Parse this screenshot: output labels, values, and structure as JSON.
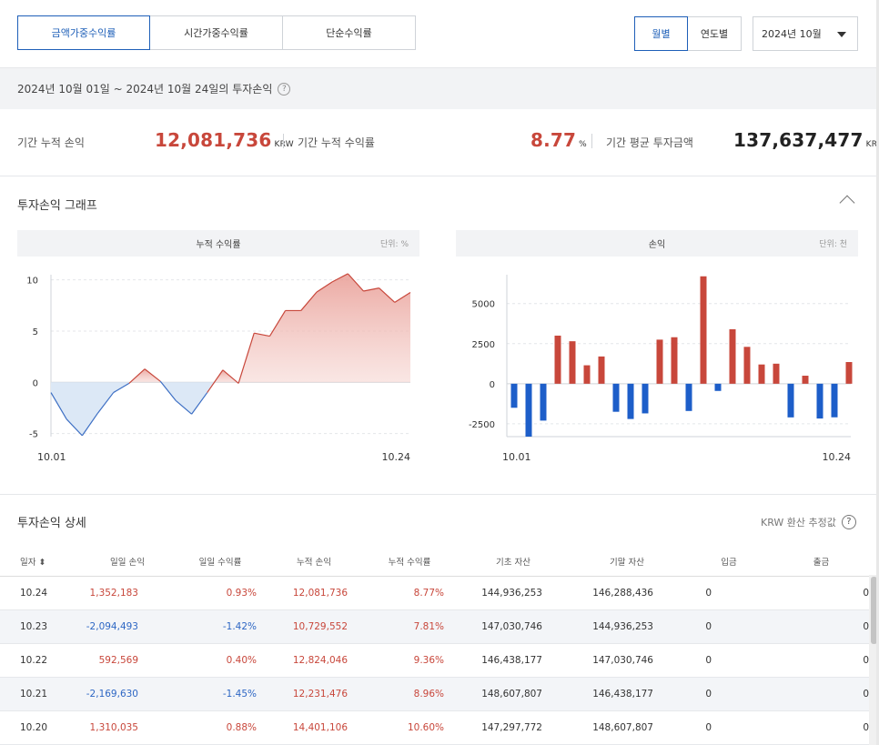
{
  "tabs": {
    "return_type": [
      "금액가중수익률",
      "시간가중수익률",
      "단순수익률"
    ],
    "period_mode": [
      "월별",
      "연도별"
    ],
    "month_select": "2024년 10월"
  },
  "period": {
    "text": "2024년 10월 01일 ~ 2024년 10월 24일의 투자손익",
    "help": "?"
  },
  "summary": {
    "cum_pl_label": "기간 누적 손익",
    "cum_pl_value": "12,081,736",
    "cum_pl_unit": "KRW",
    "cum_rate_label": "기간 누적 수익률",
    "cum_rate_value": "8.77",
    "cum_rate_unit": "%",
    "avg_invest_label": "기간 평균 투자금액",
    "avg_invest_value": "137,637,477",
    "avg_invest_unit": "KRW"
  },
  "graph_section": {
    "title": "투자손익 그래프"
  },
  "chart_data": [
    {
      "type": "area",
      "title": "누적 수익률",
      "unit_label": "단위: %",
      "x_labels": [
        "10.01",
        "10.24"
      ],
      "y_ticks": [
        10,
        5,
        0,
        -5
      ],
      "ylim": [
        -5.3,
        10.5
      ],
      "values": [
        -1.0,
        -3.6,
        -5.2,
        -3.0,
        -1.0,
        -0.1,
        1.3,
        0.1,
        -1.8,
        -3.1,
        -1.0,
        1.2,
        -0.1,
        4.8,
        4.5,
        7.0,
        7.0,
        8.8,
        9.8,
        10.6,
        8.9,
        9.2,
        7.8,
        8.77
      ],
      "colors": {
        "positive": "#c8473b",
        "negative": "#3d6fc4"
      }
    },
    {
      "type": "bar",
      "title": "손익",
      "unit_label": "단위: 천",
      "x_labels": [
        "10.01",
        "10.24"
      ],
      "y_ticks": [
        5000,
        2500,
        0,
        -2500
      ],
      "ylim": [
        -3300,
        6800
      ],
      "values": [
        -1500,
        -3300,
        -2300,
        3000,
        2650,
        1150,
        1700,
        -1750,
        -2200,
        -1850,
        2750,
        2900,
        -1700,
        6700,
        -450,
        3400,
        2300,
        1200,
        1250,
        -2100,
        500,
        -2169.63,
        -2094.493,
        1352.183
      ],
      "colors": {
        "positive": "#c8473b",
        "negative": "#1d5ec9"
      }
    }
  ],
  "detail": {
    "title": "투자손익 상세",
    "estimate": "KRW 환산 추정값",
    "help": "?",
    "columns": [
      "일자 ⬍",
      "일일 손익",
      "일일 수익률",
      "누적 손익",
      "누적 수익률",
      "기초 자산",
      "기말 자산",
      "입금",
      "출금"
    ],
    "rows": [
      {
        "date": "10.24",
        "daily_pl": "1,352,183",
        "daily_rate": "0.93%",
        "cum_pl": "12,081,736",
        "cum_rate": "8.77%",
        "begin": "144,936,253",
        "end": "146,288,436",
        "deposit": "0",
        "withdraw": "0",
        "sign": "pos"
      },
      {
        "date": "10.23",
        "daily_pl": "-2,094,493",
        "daily_rate": "-1.42%",
        "cum_pl": "10,729,552",
        "cum_rate": "7.81%",
        "begin": "147,030,746",
        "end": "144,936,253",
        "deposit": "0",
        "withdraw": "0",
        "sign": "neg"
      },
      {
        "date": "10.22",
        "daily_pl": "592,569",
        "daily_rate": "0.40%",
        "cum_pl": "12,824,046",
        "cum_rate": "9.36%",
        "begin": "146,438,177",
        "end": "147,030,746",
        "deposit": "0",
        "withdraw": "0",
        "sign": "pos"
      },
      {
        "date": "10.21",
        "daily_pl": "-2,169,630",
        "daily_rate": "-1.45%",
        "cum_pl": "12,231,476",
        "cum_rate": "8.96%",
        "begin": "148,607,807",
        "end": "146,438,177",
        "deposit": "0",
        "withdraw": "0",
        "sign": "neg"
      },
      {
        "date": "10.20",
        "daily_pl": "1,310,035",
        "daily_rate": "0.88%",
        "cum_pl": "14,401,106",
        "cum_rate": "10.60%",
        "begin": "147,297,772",
        "end": "148,607,807",
        "deposit": "0",
        "withdraw": "0",
        "sign": "pos"
      }
    ]
  }
}
